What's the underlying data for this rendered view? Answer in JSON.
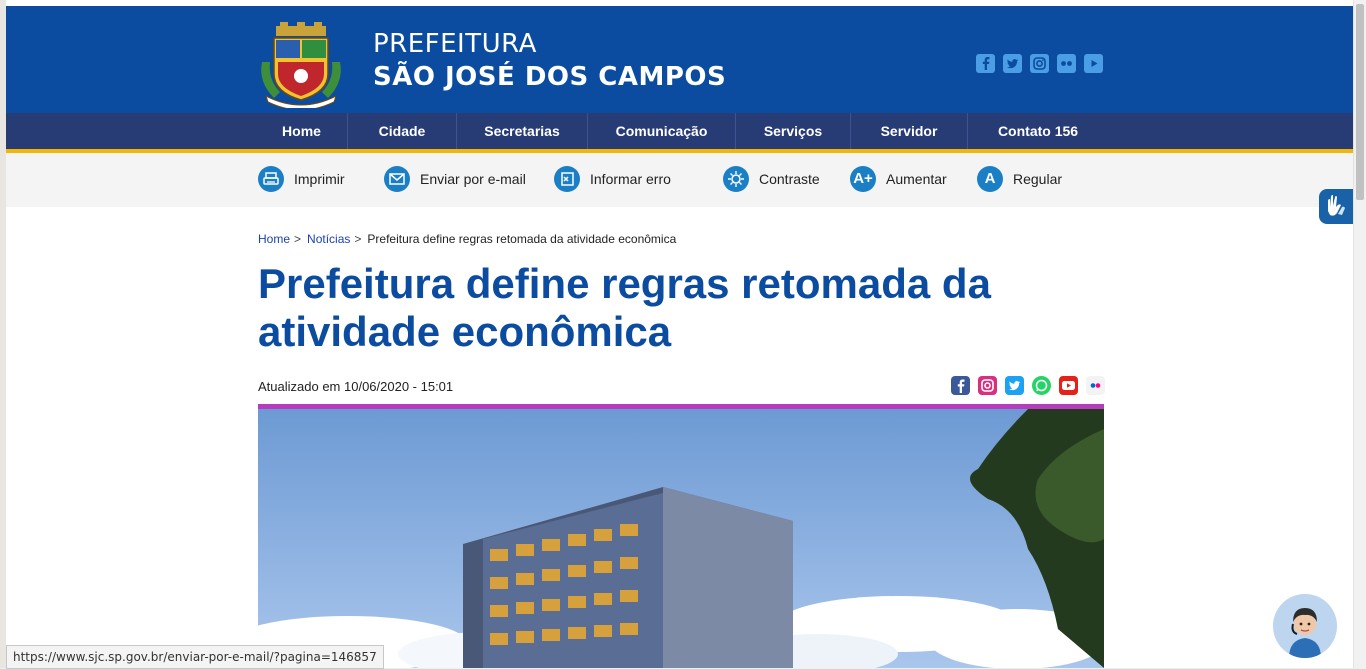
{
  "header": {
    "brand_line1": "PREFEITURA",
    "brand_line2": "SÃO JOSÉ DOS CAMPOS",
    "social_icons": [
      "facebook-icon",
      "twitter-icon",
      "instagram-icon",
      "flickr-icon",
      "youtube-icon"
    ]
  },
  "nav": {
    "items": [
      "Home",
      "Cidade",
      "Secretarias",
      "Comunicação",
      "Serviços",
      "Servidor",
      "Contato 156"
    ]
  },
  "toolbar": {
    "print": "Imprimir",
    "email": "Enviar por e-mail",
    "report_error": "Informar erro",
    "contrast": "Contraste",
    "increase": "Aumentar",
    "increase_icon": "A+",
    "regular": "Regular",
    "regular_icon": "A"
  },
  "breadcrumb": {
    "home": "Home",
    "news": "Notícias",
    "current": "Prefeitura define regras retomada da atividade econômica",
    "separator": ">"
  },
  "article": {
    "title": "Prefeitura define regras retomada da atividade econômica",
    "updated": "Atualizado em 10/06/2020 - 15:01"
  },
  "share_icons": [
    "facebook-icon",
    "instagram-icon",
    "twitter-icon",
    "whatsapp-icon",
    "youtube-icon",
    "flickr-icon"
  ],
  "status_url": "https://www.sjc.sp.gov.br/enviar-por-e-mail/?pagina=146857",
  "colors": {
    "header_blue": "#0b4ca0",
    "nav_blue": "#273c75",
    "gold": "#f2b705",
    "title_blue": "#0b4ca0",
    "divider_magenta": "#b43cbd",
    "tool_icon_blue": "#1a7fc4"
  }
}
